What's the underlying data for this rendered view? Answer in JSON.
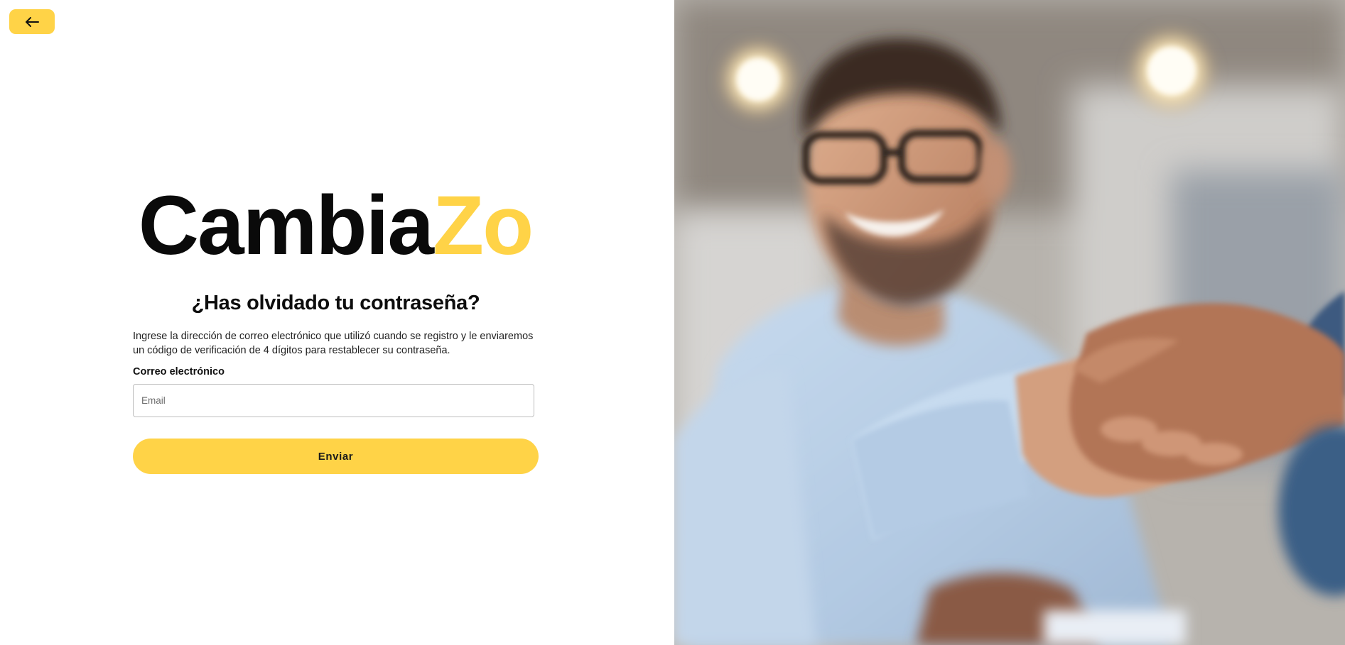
{
  "header": {
    "back_button": {
      "icon": "arrow-left-icon",
      "color": "#FFD347"
    }
  },
  "logo": {
    "text_part1": "Cambia",
    "text_part2": "Zo",
    "color_dark": "#0A0A0A",
    "color_accent": "#FFD347"
  },
  "form": {
    "title": "¿Has olvidado tu contraseña?",
    "description": "Ingrese la dirección de correo electrónico que utilizó cuando se registro y le enviaremos un código de verificación de 4 dígitos para restablecer su contraseña.",
    "email_label": "Correo electrónico",
    "email_placeholder": "Email",
    "email_value": "",
    "submit_label": "Enviar"
  },
  "theme": {
    "accent": "#FFD347",
    "background": "#FFFFFF",
    "text": "#111111"
  },
  "hero_image": {
    "subject": "handshake-photo"
  }
}
